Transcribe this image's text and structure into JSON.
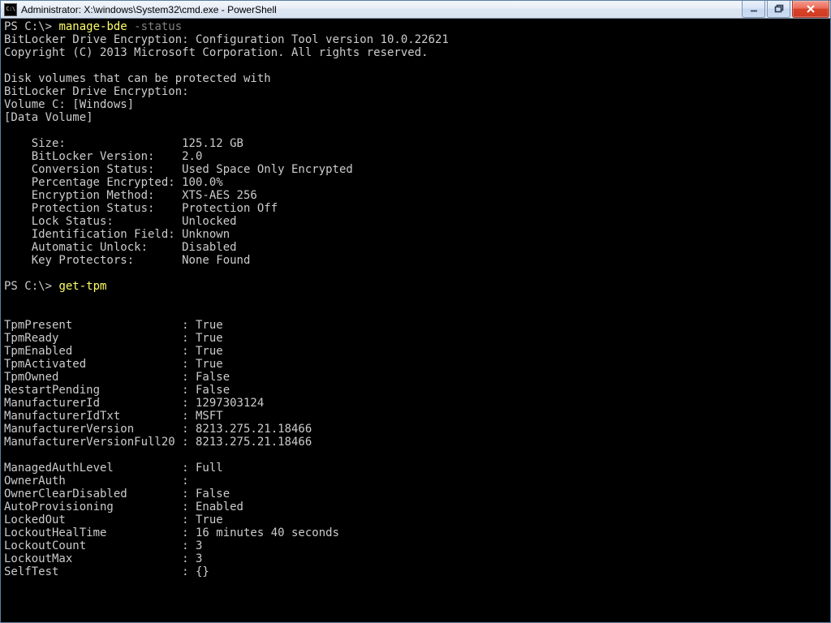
{
  "window": {
    "title": "Administrator: X:\\windows\\System32\\cmd.exe - PowerShell"
  },
  "session": {
    "prompt1": "PS C:\\> ",
    "cmd1": "manage-bde",
    "cmd1_arg": " -status",
    "banner1": "BitLocker Drive Encryption: Configuration Tool version 10.0.22621",
    "banner2": "Copyright (C) 2013 Microsoft Corporation. All rights reserved.",
    "disks_header1": "Disk volumes that can be protected with",
    "disks_header2": "BitLocker Drive Encryption:",
    "volume_line": "Volume C: [Windows]",
    "volume_type": "[Data Volume]",
    "bde_fields": [
      {
        "label": "Size:",
        "value": "125.12 GB"
      },
      {
        "label": "BitLocker Version:",
        "value": "2.0"
      },
      {
        "label": "Conversion Status:",
        "value": "Used Space Only Encrypted"
      },
      {
        "label": "Percentage Encrypted:",
        "value": "100.0%"
      },
      {
        "label": "Encryption Method:",
        "value": "XTS-AES 256"
      },
      {
        "label": "Protection Status:",
        "value": "Protection Off"
      },
      {
        "label": "Lock Status:",
        "value": "Unlocked"
      },
      {
        "label": "Identification Field:",
        "value": "Unknown"
      },
      {
        "label": "Automatic Unlock:",
        "value": "Disabled"
      },
      {
        "label": "Key Protectors:",
        "value": "None Found"
      }
    ],
    "prompt2": "PS C:\\> ",
    "cmd2": "get-tpm",
    "tpm_fields_a": [
      {
        "label": "TpmPresent",
        "value": "True"
      },
      {
        "label": "TpmReady",
        "value": "True"
      },
      {
        "label": "TpmEnabled",
        "value": "True"
      },
      {
        "label": "TpmActivated",
        "value": "True"
      },
      {
        "label": "TpmOwned",
        "value": "False"
      },
      {
        "label": "RestartPending",
        "value": "False"
      },
      {
        "label": "ManufacturerId",
        "value": "1297303124"
      },
      {
        "label": "ManufacturerIdTxt",
        "value": "MSFT"
      },
      {
        "label": "ManufacturerVersion",
        "value": "8213.275.21.18466"
      },
      {
        "label": "ManufacturerVersionFull20",
        "value": "8213.275.21.18466"
      }
    ],
    "tpm_fields_b": [
      {
        "label": "ManagedAuthLevel",
        "value": "Full"
      },
      {
        "label": "OwnerAuth",
        "value": ""
      },
      {
        "label": "OwnerClearDisabled",
        "value": "False"
      },
      {
        "label": "AutoProvisioning",
        "value": "Enabled"
      },
      {
        "label": "LockedOut",
        "value": "True"
      },
      {
        "label": "LockoutHealTime",
        "value": "16 minutes 40 seconds"
      },
      {
        "label": "LockoutCount",
        "value": "3"
      },
      {
        "label": "LockoutMax",
        "value": "3"
      },
      {
        "label": "SelfTest",
        "value": "{}"
      }
    ]
  }
}
